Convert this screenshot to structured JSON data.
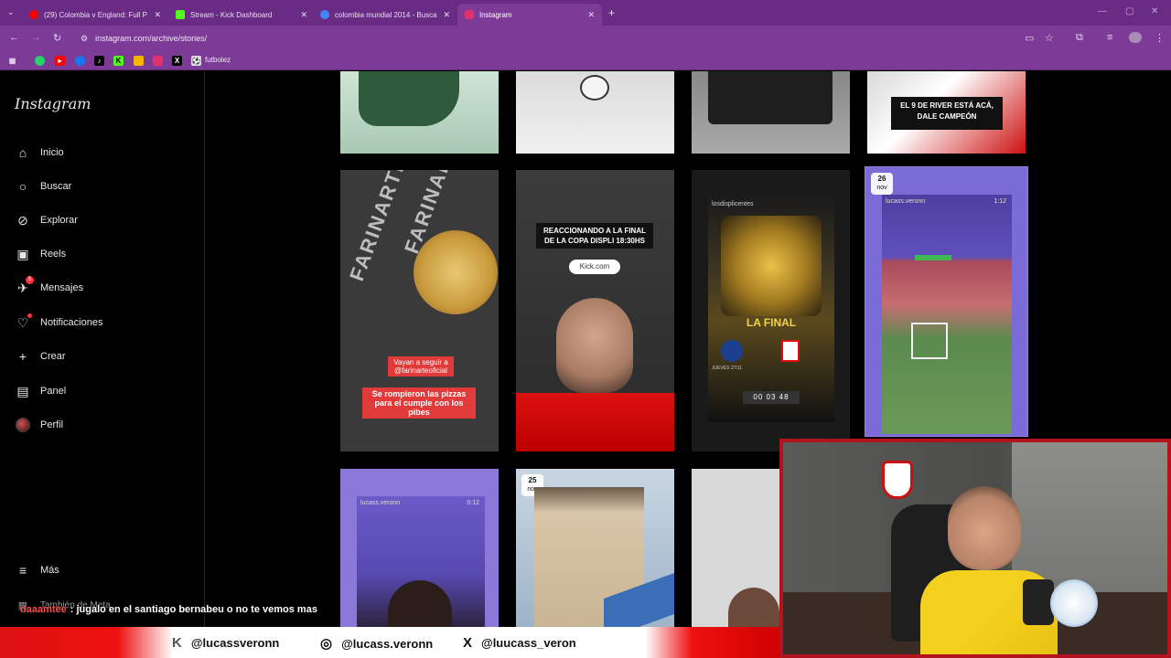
{
  "browser": {
    "tabs": [
      {
        "label": "(29) Colombia v England: Full P",
        "favicon_color": "#ff0000"
      },
      {
        "label": "Stream - Kick Dashboard",
        "favicon_color": "#53fc18"
      },
      {
        "label": "colombia mundial 2014 - Busca",
        "favicon_color": "#4285f4"
      },
      {
        "label": "Instagram",
        "favicon_color": "#e1306c"
      }
    ],
    "url": "instagram.com/archive/stories/",
    "bookmark_label": "futbolez"
  },
  "sidebar": {
    "logo": "Instagram",
    "items": [
      {
        "label": "Inicio",
        "icon": "home-icon"
      },
      {
        "label": "Buscar",
        "icon": "search-icon"
      },
      {
        "label": "Explorar",
        "icon": "compass-icon"
      },
      {
        "label": "Reels",
        "icon": "reels-icon"
      },
      {
        "label": "Mensajes",
        "icon": "messenger-icon",
        "badge": "5"
      },
      {
        "label": "Notificaciones",
        "icon": "heart-icon"
      },
      {
        "label": "Crear",
        "icon": "plus-icon"
      },
      {
        "label": "Panel",
        "icon": "panel-icon"
      },
      {
        "label": "Perfil",
        "icon": "avatar"
      }
    ],
    "more_label": "Más",
    "meta_label": "También de Meta"
  },
  "stories": {
    "row1_caption": "EL 9 DE RIVER ESTÁ ACÁ, DALE CAMPEÓN",
    "pizza_caption1": "Vayan a seguir a @farinarteoficial",
    "pizza_caption2": "Se rompieron las pizzas para el cumple con los pibes",
    "farinarte_word": "FARINARTE",
    "reaction_title": "REACCIONANDO A LA FINAL DE LA COPA DISPLI 18:30HS",
    "kick_link": "Kick.com",
    "poster_account": "losdisplicentes",
    "poster_title": "LA FINAL",
    "poster_date": "JUEVES 27/11",
    "poster_countdown": "00 03 48",
    "selected_account": "lucass.veronn",
    "selected_time": "1:12",
    "selected_date_day": "26",
    "selected_date_month": "nov",
    "row3_account": "lucass.veronn",
    "row3_time": "0:12",
    "row3_date_day": "25",
    "row3_date_month": "nov"
  },
  "stream": {
    "chat_user": "daaamtee",
    "chat_message": ": jugalo en el santiago bernabeu o no te vemos mas",
    "socials": [
      {
        "icon": "kick-icon",
        "handle": "@lucassveronn"
      },
      {
        "icon": "instagram-icon",
        "handle": "@lucass.veronn"
      },
      {
        "icon": "x-icon",
        "handle": "@luucass_veron"
      }
    ]
  }
}
